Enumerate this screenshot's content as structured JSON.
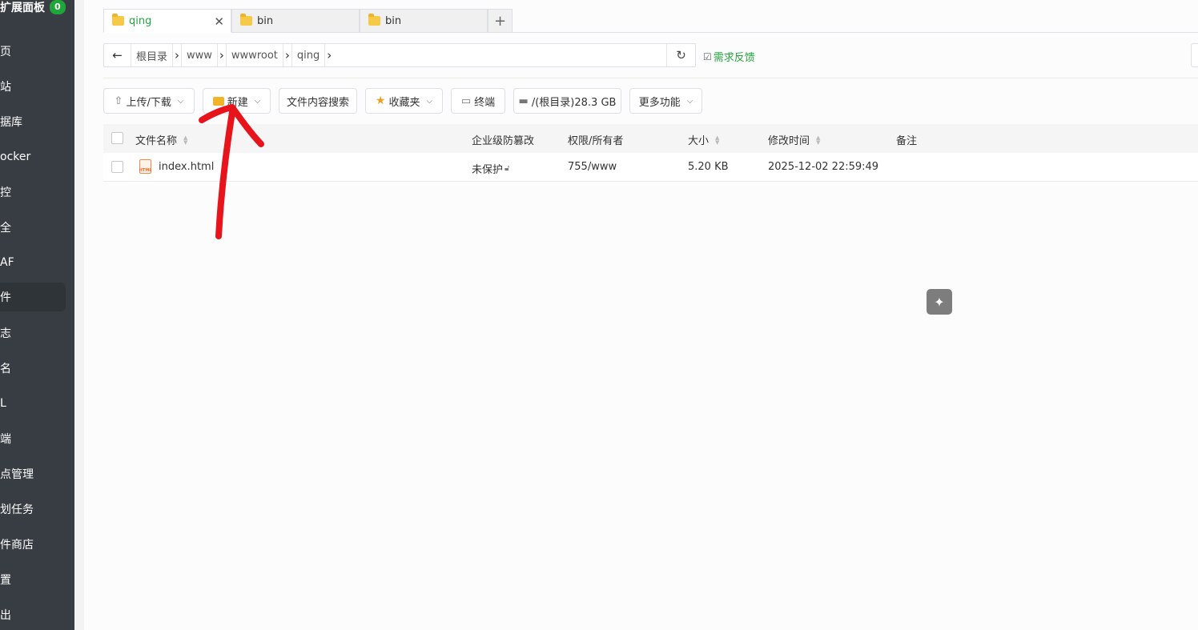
{
  "sidebar": {
    "header": {
      "title": "扩展面板",
      "badge": "0"
    },
    "items": [
      {
        "label": "页"
      },
      {
        "label": "站"
      },
      {
        "label": "据库"
      },
      {
        "label": "ocker"
      },
      {
        "label": "控"
      },
      {
        "label": "全"
      },
      {
        "label": "AF"
      },
      {
        "label": "件"
      },
      {
        "label": "志"
      },
      {
        "label": "名"
      },
      {
        "label": "L"
      },
      {
        "label": "端"
      },
      {
        "label": "点管理"
      },
      {
        "label": "划任务"
      },
      {
        "label": "件商店"
      },
      {
        "label": "置"
      },
      {
        "label": "出"
      }
    ]
  },
  "tabs": [
    {
      "label": "qing",
      "active": true,
      "close": "✕"
    },
    {
      "label": "bin"
    },
    {
      "label": "bin"
    }
  ],
  "tab_add": "+",
  "path": {
    "back": "←",
    "crumbs": [
      "根目录",
      "www",
      "wwwroot",
      "qing"
    ],
    "refresh": "↻"
  },
  "feedback": "需求反馈",
  "toolbar": {
    "upload": "上传/下载",
    "new": "新建",
    "search": "文件内容搜索",
    "favorites": "收藏夹",
    "terminal": "终端",
    "disk": "/(根目录)28.3 GB",
    "more": "更多功能"
  },
  "table": {
    "headers": {
      "name": "文件名称",
      "protect": "企业级防篡改",
      "perm": "权限/所有者",
      "size": "大小",
      "mtime": "修改时间",
      "note": "备注"
    },
    "rows": [
      {
        "name": "index.html",
        "protect": "未保护",
        "perm": "755/www",
        "size": "5.20 KB",
        "mtime": "2025-12-02 22:59:49",
        "note": ""
      }
    ]
  },
  "annotation": {
    "color": "#e8141c"
  }
}
